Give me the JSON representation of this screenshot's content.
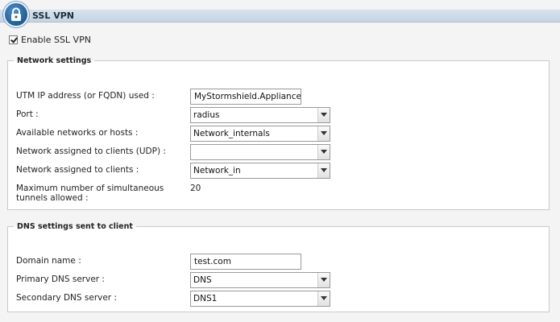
{
  "header": {
    "title": "SSL VPN",
    "icon": "lock-icon"
  },
  "enable": {
    "label": "Enable SSL VPN",
    "checked": true
  },
  "network_settings": {
    "legend": "Network settings",
    "utm_ip": {
      "label": "UTM IP address (or FQDN) used :",
      "value": "MyStormshield.Appliance.c"
    },
    "port": {
      "label": "Port :",
      "value": "radius"
    },
    "available_networks": {
      "label": "Available networks or hosts  :",
      "value": "Network_internals"
    },
    "udp_clients": {
      "label": "Network assigned to clients (UDP) :",
      "value": ""
    },
    "clients": {
      "label": "Network assigned to clients :",
      "value": "Network_in"
    },
    "max_tunnels": {
      "label": "Maximum number of simultaneous tunnels allowed :",
      "value": "20"
    }
  },
  "dns_settings": {
    "legend": "DNS settings sent to client",
    "domain": {
      "label": "Domain name :",
      "value": "test.com"
    },
    "primary": {
      "label": "Primary DNS server :",
      "value": "DNS"
    },
    "secondary": {
      "label": "Secondary DNS server :",
      "value": "DNS1"
    }
  }
}
